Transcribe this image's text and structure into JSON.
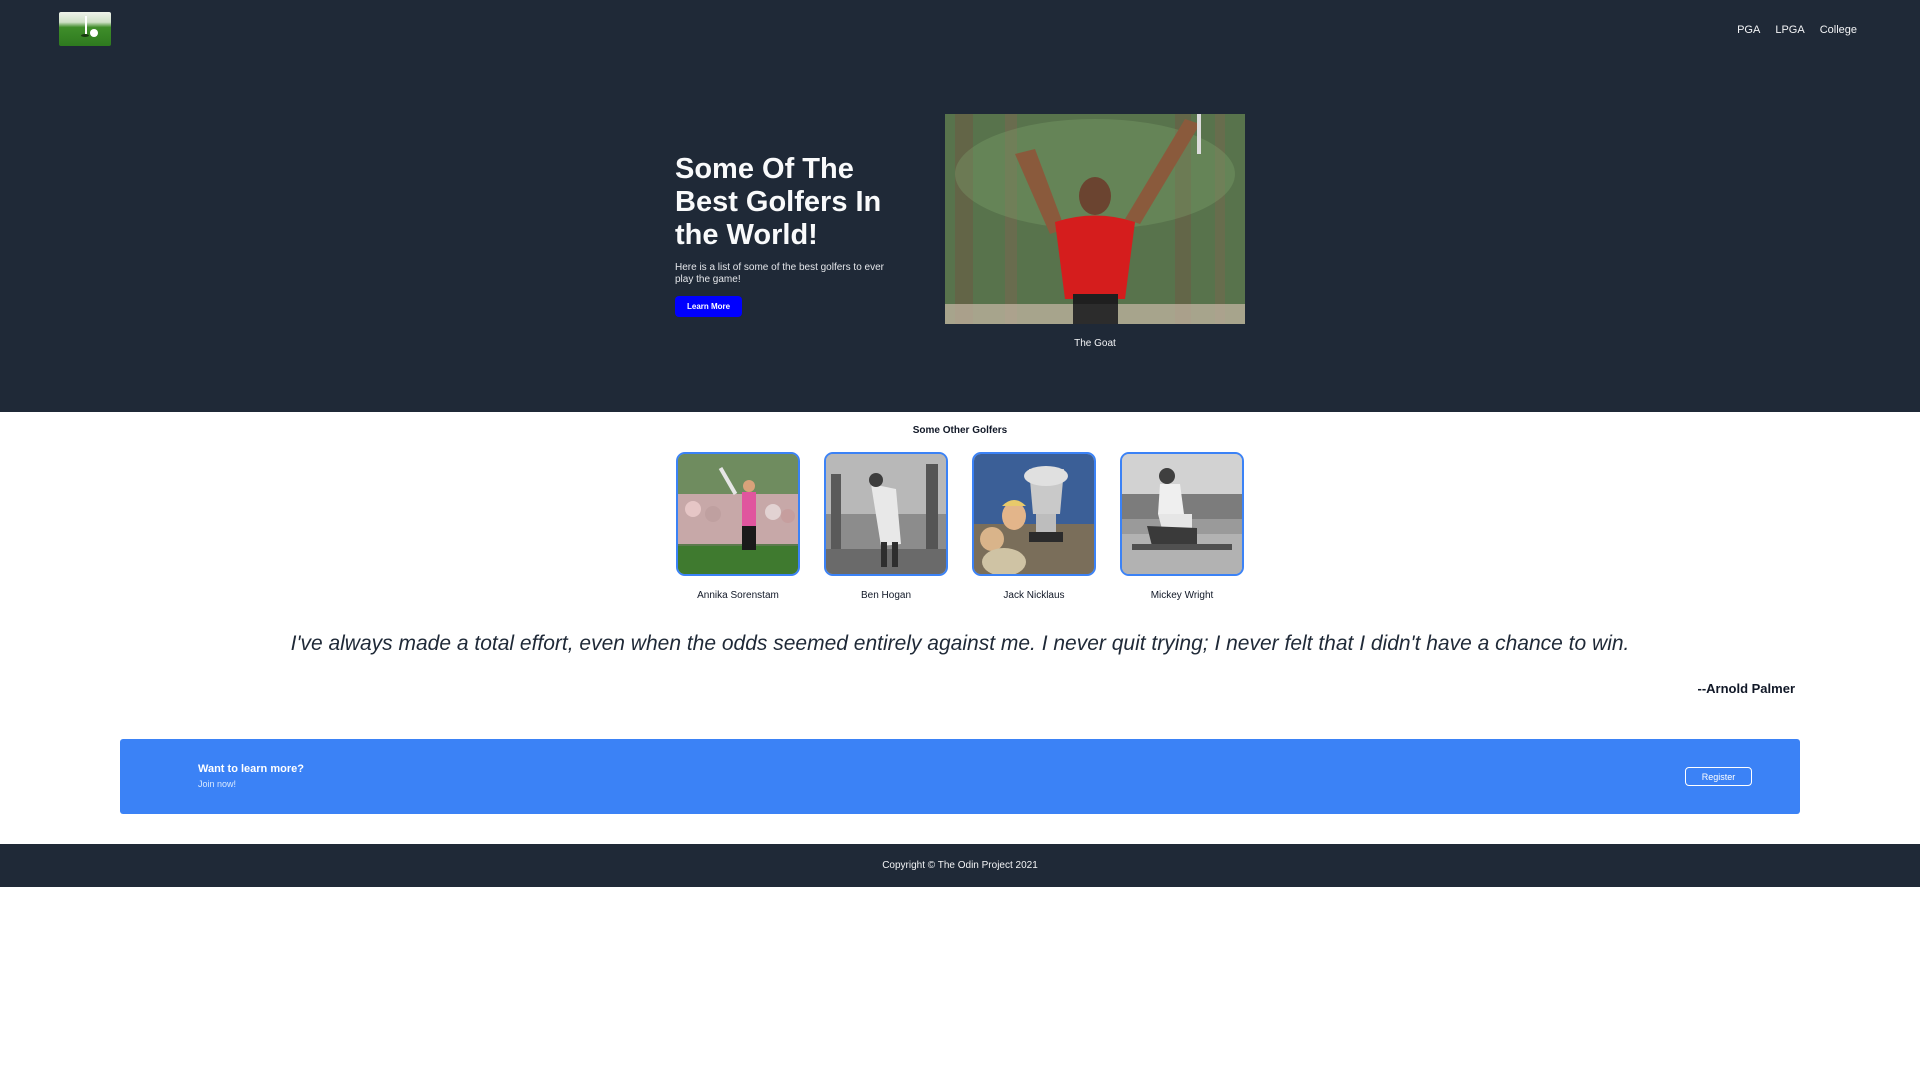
{
  "nav": {
    "logo_icon": "golf-hole-logo-icon",
    "links": [
      "PGA",
      "LPGA",
      "College"
    ]
  },
  "hero": {
    "title": "Some Of The Best Golfers In the World!",
    "subtitle": "Here is a list of some of the best golfers to ever play the game!",
    "button_label": "Learn More",
    "image_caption": "The Goat"
  },
  "golfers": {
    "title": "Some Other Golfers",
    "items": [
      {
        "name": "Annika Sorenstam"
      },
      {
        "name": "Ben Hogan"
      },
      {
        "name": "Jack Nicklaus"
      },
      {
        "name": "Mickey Wright"
      }
    ]
  },
  "quote": {
    "text": "I've always made a total effort, even when the odds seemed entirely against me. I never quit trying; I never felt that I didn't have a chance to win.",
    "author": "--Arnold Palmer"
  },
  "cta": {
    "title": "Want to learn more?",
    "subtitle": "Join now!",
    "button_label": "Register"
  },
  "footer": {
    "copyright": "Copyright © The Odin Project 2021"
  },
  "colors": {
    "header_bg": "#1f2937",
    "accent_blue": "#3b82f6",
    "button_blue": "#0000ff"
  }
}
